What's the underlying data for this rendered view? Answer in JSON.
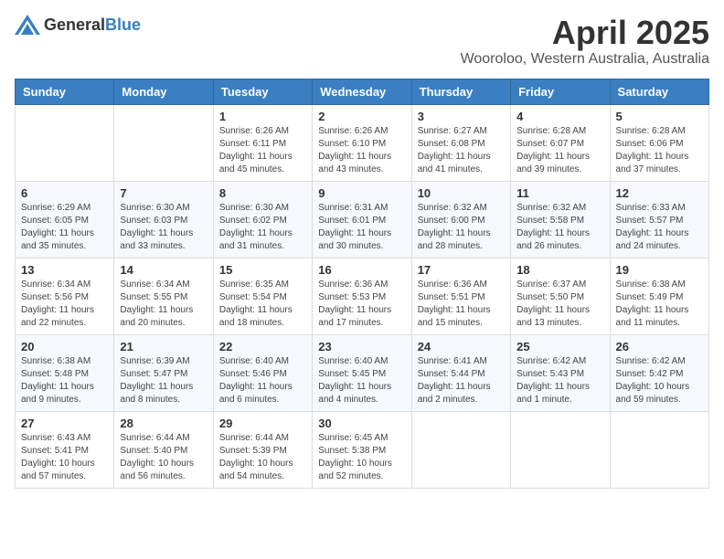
{
  "logo": {
    "general": "General",
    "blue": "Blue"
  },
  "title": "April 2025",
  "subtitle": "Wooroloo, Western Australia, Australia",
  "weekdays": [
    "Sunday",
    "Monday",
    "Tuesday",
    "Wednesday",
    "Thursday",
    "Friday",
    "Saturday"
  ],
  "weeks": [
    [
      {
        "day": "",
        "info": ""
      },
      {
        "day": "",
        "info": ""
      },
      {
        "day": "1",
        "info": "Sunrise: 6:26 AM\nSunset: 6:11 PM\nDaylight: 11 hours and 45 minutes."
      },
      {
        "day": "2",
        "info": "Sunrise: 6:26 AM\nSunset: 6:10 PM\nDaylight: 11 hours and 43 minutes."
      },
      {
        "day": "3",
        "info": "Sunrise: 6:27 AM\nSunset: 6:08 PM\nDaylight: 11 hours and 41 minutes."
      },
      {
        "day": "4",
        "info": "Sunrise: 6:28 AM\nSunset: 6:07 PM\nDaylight: 11 hours and 39 minutes."
      },
      {
        "day": "5",
        "info": "Sunrise: 6:28 AM\nSunset: 6:06 PM\nDaylight: 11 hours and 37 minutes."
      }
    ],
    [
      {
        "day": "6",
        "info": "Sunrise: 6:29 AM\nSunset: 6:05 PM\nDaylight: 11 hours and 35 minutes."
      },
      {
        "day": "7",
        "info": "Sunrise: 6:30 AM\nSunset: 6:03 PM\nDaylight: 11 hours and 33 minutes."
      },
      {
        "day": "8",
        "info": "Sunrise: 6:30 AM\nSunset: 6:02 PM\nDaylight: 11 hours and 31 minutes."
      },
      {
        "day": "9",
        "info": "Sunrise: 6:31 AM\nSunset: 6:01 PM\nDaylight: 11 hours and 30 minutes."
      },
      {
        "day": "10",
        "info": "Sunrise: 6:32 AM\nSunset: 6:00 PM\nDaylight: 11 hours and 28 minutes."
      },
      {
        "day": "11",
        "info": "Sunrise: 6:32 AM\nSunset: 5:58 PM\nDaylight: 11 hours and 26 minutes."
      },
      {
        "day": "12",
        "info": "Sunrise: 6:33 AM\nSunset: 5:57 PM\nDaylight: 11 hours and 24 minutes."
      }
    ],
    [
      {
        "day": "13",
        "info": "Sunrise: 6:34 AM\nSunset: 5:56 PM\nDaylight: 11 hours and 22 minutes."
      },
      {
        "day": "14",
        "info": "Sunrise: 6:34 AM\nSunset: 5:55 PM\nDaylight: 11 hours and 20 minutes."
      },
      {
        "day": "15",
        "info": "Sunrise: 6:35 AM\nSunset: 5:54 PM\nDaylight: 11 hours and 18 minutes."
      },
      {
        "day": "16",
        "info": "Sunrise: 6:36 AM\nSunset: 5:53 PM\nDaylight: 11 hours and 17 minutes."
      },
      {
        "day": "17",
        "info": "Sunrise: 6:36 AM\nSunset: 5:51 PM\nDaylight: 11 hours and 15 minutes."
      },
      {
        "day": "18",
        "info": "Sunrise: 6:37 AM\nSunset: 5:50 PM\nDaylight: 11 hours and 13 minutes."
      },
      {
        "day": "19",
        "info": "Sunrise: 6:38 AM\nSunset: 5:49 PM\nDaylight: 11 hours and 11 minutes."
      }
    ],
    [
      {
        "day": "20",
        "info": "Sunrise: 6:38 AM\nSunset: 5:48 PM\nDaylight: 11 hours and 9 minutes."
      },
      {
        "day": "21",
        "info": "Sunrise: 6:39 AM\nSunset: 5:47 PM\nDaylight: 11 hours and 8 minutes."
      },
      {
        "day": "22",
        "info": "Sunrise: 6:40 AM\nSunset: 5:46 PM\nDaylight: 11 hours and 6 minutes."
      },
      {
        "day": "23",
        "info": "Sunrise: 6:40 AM\nSunset: 5:45 PM\nDaylight: 11 hours and 4 minutes."
      },
      {
        "day": "24",
        "info": "Sunrise: 6:41 AM\nSunset: 5:44 PM\nDaylight: 11 hours and 2 minutes."
      },
      {
        "day": "25",
        "info": "Sunrise: 6:42 AM\nSunset: 5:43 PM\nDaylight: 11 hours and 1 minute."
      },
      {
        "day": "26",
        "info": "Sunrise: 6:42 AM\nSunset: 5:42 PM\nDaylight: 10 hours and 59 minutes."
      }
    ],
    [
      {
        "day": "27",
        "info": "Sunrise: 6:43 AM\nSunset: 5:41 PM\nDaylight: 10 hours and 57 minutes."
      },
      {
        "day": "28",
        "info": "Sunrise: 6:44 AM\nSunset: 5:40 PM\nDaylight: 10 hours and 56 minutes."
      },
      {
        "day": "29",
        "info": "Sunrise: 6:44 AM\nSunset: 5:39 PM\nDaylight: 10 hours and 54 minutes."
      },
      {
        "day": "30",
        "info": "Sunrise: 6:45 AM\nSunset: 5:38 PM\nDaylight: 10 hours and 52 minutes."
      },
      {
        "day": "",
        "info": ""
      },
      {
        "day": "",
        "info": ""
      },
      {
        "day": "",
        "info": ""
      }
    ]
  ]
}
